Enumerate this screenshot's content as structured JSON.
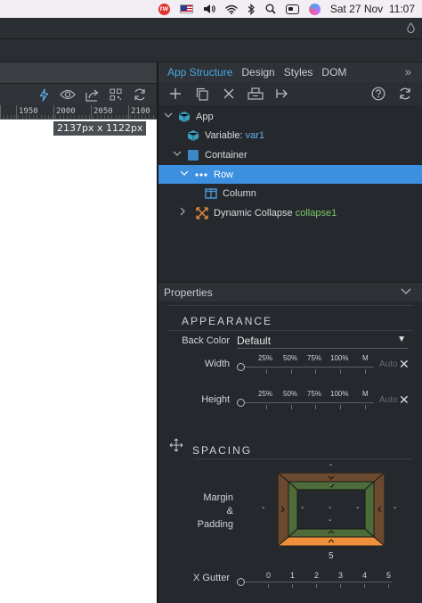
{
  "menubar": {
    "app_icon": "rw-app-icon",
    "date": "Sat 27 Nov",
    "time": "11:07"
  },
  "ruler": {
    "labels": [
      "1950",
      "2000",
      "2050",
      "2100"
    ]
  },
  "canvas": {
    "size_label": "2137px x 1122px"
  },
  "panel": {
    "tabs": [
      {
        "label": "App Structure",
        "active": true
      },
      {
        "label": "Design",
        "active": false
      },
      {
        "label": "Styles",
        "active": false
      },
      {
        "label": "DOM",
        "active": false
      }
    ],
    "more": "»"
  },
  "tree": {
    "app": {
      "label": "App"
    },
    "variable": {
      "label": "Variable:",
      "name": "var1"
    },
    "container": {
      "label": "Container"
    },
    "row": {
      "label": "Row"
    },
    "column": {
      "label": "Column"
    },
    "collapse": {
      "label": "Dynamic Collapse",
      "name": "collapse1"
    }
  },
  "properties": {
    "header": "Properties",
    "appearance": {
      "title": "APPEARANCE",
      "back_color_label": "Back Color",
      "back_color_value": "Default",
      "width_label": "Width",
      "height_label": "Height",
      "slider_marks": [
        "25%",
        "50%",
        "75%",
        "100%",
        "M"
      ],
      "auto_label": "Auto"
    },
    "spacing": {
      "title": "SPACING",
      "margin_label_1": "Margin",
      "margin_label_2": "&",
      "margin_label_3": "Padding",
      "top_outer": "-",
      "top_inner": "-",
      "left_outer": "-",
      "left_inner": "-",
      "center": "-",
      "center_bottom": "-",
      "right_inner": "-",
      "right_outer": "-",
      "bottom_outer": "5",
      "gutter_label": "X Gutter",
      "gutter_marks": [
        "0",
        "1",
        "2",
        "3",
        "4",
        "5"
      ]
    }
  },
  "colors": {
    "accent": "#3d8fe0",
    "tab_active": "#4aa7e8",
    "var_name": "#5fb4ef",
    "collapse_name": "#7ec96e",
    "margin_box": "#6b4a30",
    "padding_box": "#4e6b3a",
    "margin_bottom": "#f0903a"
  }
}
